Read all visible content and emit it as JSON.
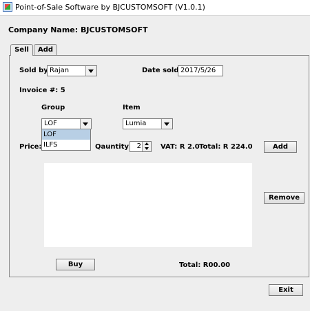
{
  "window": {
    "title": "Point-of-Sale Software by BJCUSTOMSOFT   (V1.0.1)"
  },
  "company": {
    "label": "Company Name: BJCUSTOMSOFT"
  },
  "tabs": [
    {
      "label": "Sell"
    },
    {
      "label": "Add"
    }
  ],
  "sell": {
    "sold_by_label": "Sold by:",
    "sold_by_value": "Rajan",
    "date_sold_label": "Date sold:",
    "date_sold_value": "2017/5/26",
    "invoice": "Invoice #: 5",
    "group_label": "Group",
    "item_label": "Item",
    "group_value": "LOF",
    "group_options": [
      "LOF",
      "ILFS"
    ],
    "item_value": "Lumia",
    "price_label": "Price: R",
    "quantity_label": "Qauntity:",
    "quantity_value": "2",
    "vat": "VAT: R 2.0",
    "total_line": "Total: R 224.0",
    "add_button": "Add",
    "remove_button": "Remove",
    "buy_button": "Buy",
    "grand_total": "Total: R00.00"
  },
  "exit_button": "Exit"
}
